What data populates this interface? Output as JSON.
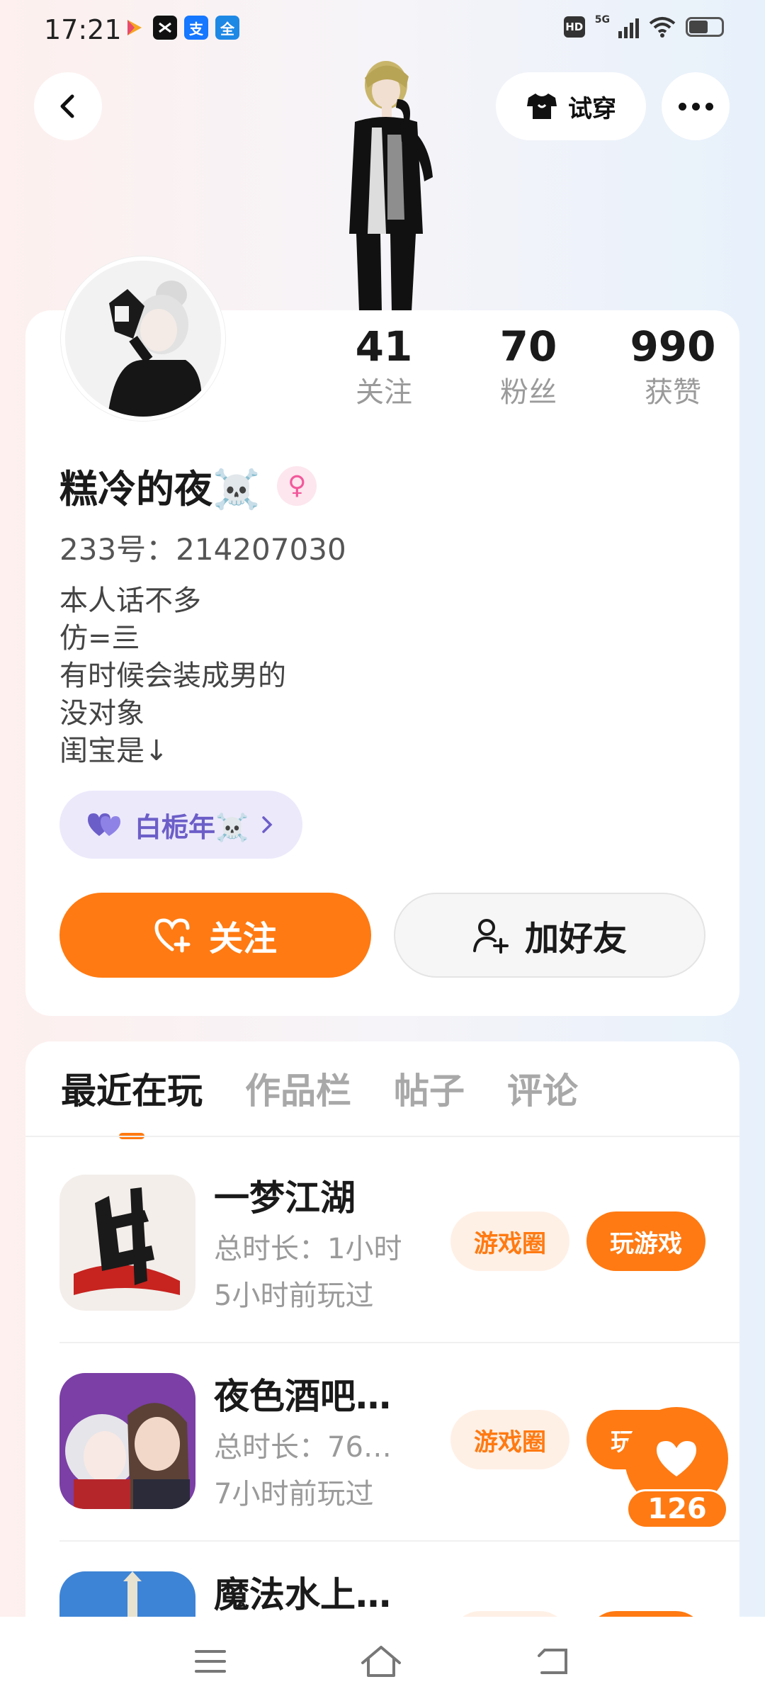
{
  "status_bar": {
    "time": "17:21",
    "apps": [
      {
        "icon": "video-app-icon",
        "color": "#f5a623"
      },
      {
        "icon": "capcut-icon",
        "color": "#111111"
      },
      {
        "icon": "alipay-icon",
        "color": "#1677ff",
        "glyph": "支"
      },
      {
        "icon": "quanmin-icon",
        "color": "#1e88e5",
        "glyph": "全"
      }
    ],
    "hd": "HD",
    "network": "5G"
  },
  "header": {
    "tryon_label": "试穿"
  },
  "profile": {
    "stats": [
      {
        "value": "41",
        "label": "关注"
      },
      {
        "value": "70",
        "label": "粉丝"
      },
      {
        "value": "990",
        "label": "获赞"
      }
    ],
    "nickname": "糕冷的夜☠️",
    "gender_symbol": "♀",
    "uid": "233号：214207030",
    "bio": [
      "本人话不多",
      "仿=亖",
      "有时候会装成男的",
      "没对象",
      "闺宝是↓"
    ],
    "cp_tag": "白栀年☠️",
    "follow_label": "关注",
    "add_friend_label": "加好友"
  },
  "tabs": [
    {
      "label": "最近在玩",
      "active": true
    },
    {
      "label": "作品栏",
      "active": false
    },
    {
      "label": "帖子",
      "active": false
    },
    {
      "label": "评论",
      "active": false
    }
  ],
  "games": [
    {
      "name": "一梦江湖",
      "duration": "总时长：1小时",
      "last_played": "5小时前玩过",
      "circle_label": "游戏圈",
      "play_label": "玩游戏"
    },
    {
      "name": "夜色酒吧…",
      "duration": "总时长：76…",
      "last_played": "7小时前玩过",
      "circle_label": "游戏圈",
      "play_label": "玩"
    },
    {
      "name": "魔法水上…",
      "duration": "",
      "last_played": "",
      "circle_label": "",
      "play_label": ""
    }
  ],
  "like_count": "126",
  "colors": {
    "accent": "#ff7a12",
    "accent_light": "#fff0e6",
    "cp_tag_bg": "#ece9fb",
    "cp_tag_text": "#6c5ec8"
  }
}
